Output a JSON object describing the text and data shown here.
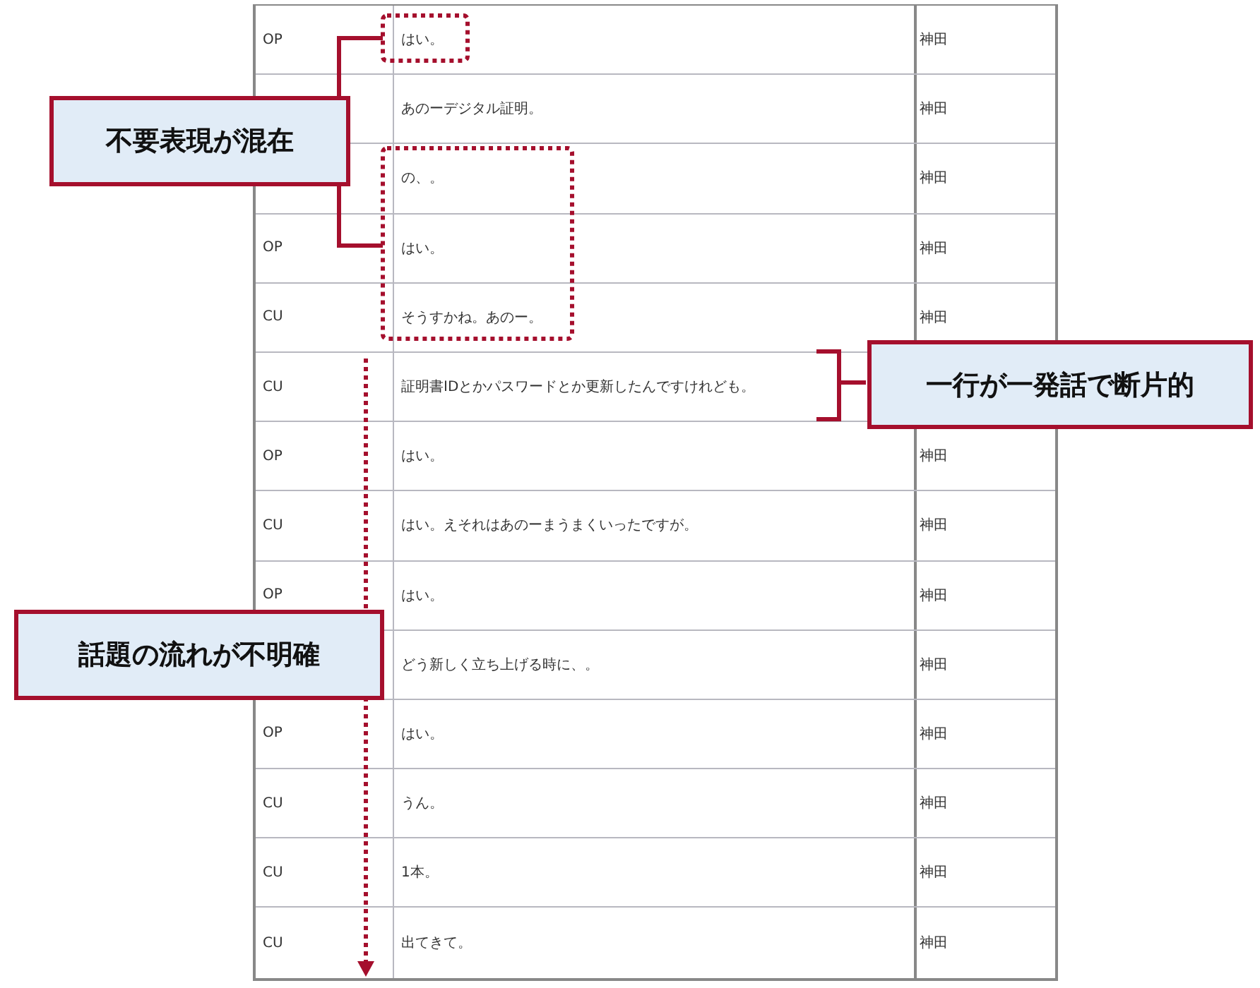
{
  "rows": [
    {
      "speaker": "OP",
      "utterance": "はい。",
      "name": "神田"
    },
    {
      "utterance": "あのーデジタル証明。",
      "name": "神田"
    },
    {
      "utterance": "の、。",
      "name": "神田"
    },
    {
      "speaker": "OP",
      "utterance": "はい。",
      "name": "神田"
    },
    {
      "speaker": "CU",
      "utterance": "そうすかね。あのー。",
      "name": "神田"
    },
    {
      "speaker": "CU",
      "utterance": "証明書IDとかパスワードとか更新したんですけれども。"
    },
    {
      "speaker": "OP",
      "utterance": "はい。",
      "name": "神田"
    },
    {
      "speaker": "CU",
      "utterance": "はい。えそれはあのーまうまくいったですが。",
      "name": "神田"
    },
    {
      "speaker": "OP",
      "utterance": "はい。",
      "name": "神田"
    },
    {
      "utterance": "どう新しく立ち上げる時に、。",
      "name": "神田"
    },
    {
      "speaker": "OP",
      "utterance": "はい。",
      "name": "神田"
    },
    {
      "speaker": "CU",
      "utterance": "うん。",
      "name": "神田"
    },
    {
      "speaker": "CU",
      "utterance": "1本。",
      "name": "神田"
    },
    {
      "speaker": "CU",
      "utterance": "出てきて。",
      "name": "神田"
    }
  ],
  "callouts": [
    {
      "text": "不要表現が混在"
    },
    {
      "text": "一行が一発話で断片的"
    },
    {
      "text": "話題の流れが不明確"
    }
  ]
}
